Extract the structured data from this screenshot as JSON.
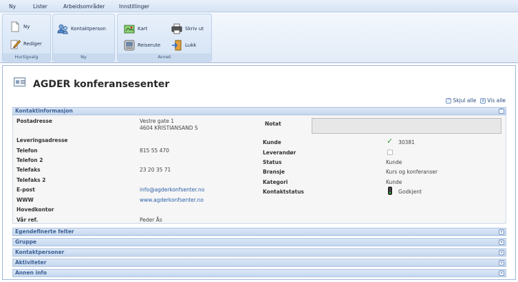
{
  "menu": [
    "Ny",
    "Lister",
    "Arbeidsområder",
    "Innstillinger"
  ],
  "ribbon": {
    "hurtigvalg": {
      "label": "Hurtigvalg",
      "ny": "Ny",
      "rediger": "Rediger"
    },
    "ny": {
      "label": "Ny",
      "kontaktperson": "Kontaktperson"
    },
    "annet": {
      "label": "Annet",
      "kart": "Kart",
      "reiserute": "Reiserute",
      "skriv_ut": "Skriv ut",
      "lukk": "Lukk"
    }
  },
  "page": {
    "title": "AGDER konferansesenter",
    "skjul_alle": "Skjul alle",
    "vis_alle": "Vis alle"
  },
  "kontaktinfo": {
    "header": "Kontaktinformasjon",
    "left": {
      "postadresse_label": "Postadresse",
      "postadresse_line1": "Vestre gate 1",
      "postadresse_line2": "4604 KRISTIANSAND S",
      "leveringsadresse_label": "Leveringsadresse",
      "telefon_label": "Telefon",
      "telefon_value": "815 55 470",
      "telefon2_label": "Telefon 2",
      "telefaks_label": "Telefaks",
      "telefaks_value": "23 20 35 71",
      "telefaks2_label": "Telefaks 2",
      "epost_label": "E-post",
      "epost_value": "info@agderkonfsenter.no",
      "www_label": "WWW",
      "www_value": "www.agderkonfsenter.no",
      "hovedkontor_label": "Hovedkontor",
      "var_ref_label": "Vår ref.",
      "var_ref_value": "Peder Ås"
    },
    "right": {
      "notat_label": "Notat",
      "kunde_label": "Kunde",
      "kunde_value": "30381",
      "leverandor_label": "Leverandør",
      "status_label": "Status",
      "status_value": "Kunde",
      "bransje_label": "Bransje",
      "bransje_value": "Kurs og konferanser",
      "kategori_label": "Kategori",
      "kategori_value": "Kunde",
      "kontaktstatus_label": "Kontaktstatus",
      "kontaktstatus_value": "Godkjent"
    }
  },
  "collapsed_sections": [
    "Egendefinerte felter",
    "Gruppe",
    "Kontaktpersoner",
    "Aktiviteter",
    "Annen info"
  ],
  "colors": {
    "section_text": "#3a5f93",
    "link": "#2a5ea8",
    "check_green": "#2a9a2a"
  }
}
